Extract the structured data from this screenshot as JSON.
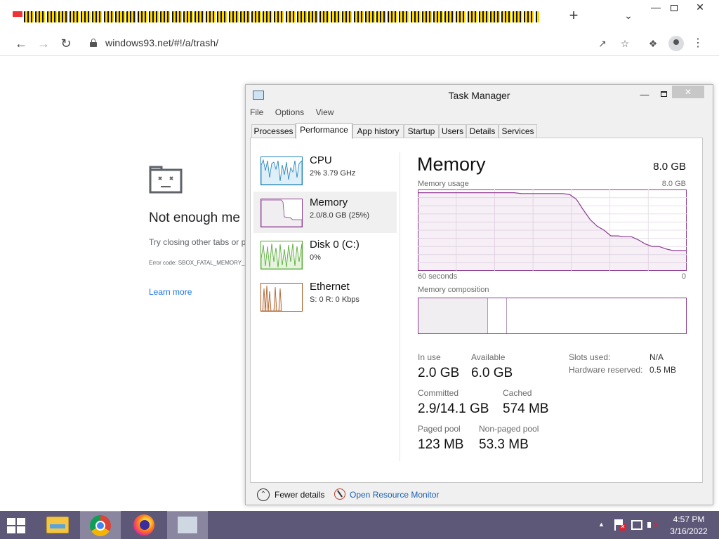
{
  "browser": {
    "tab_count": 49,
    "url": "windows93.net/#!/a/trash/",
    "icons": {
      "back": "arrow-left-icon",
      "forward": "arrow-right-icon",
      "reload": "reload-icon",
      "new_tab": "plus-icon",
      "tab_search": "chevron-down-icon",
      "share": "share-icon",
      "bookmark": "star-icon",
      "extensions": "puzzle-icon",
      "profile": "avatar-icon",
      "menu": "kebab-icon"
    }
  },
  "error_page": {
    "title": "Not enough me",
    "subtitle": "Try closing other tabs or p",
    "error_code": "Error code: SBOX_FATAL_MEMORY_",
    "learn_more": "Learn more"
  },
  "task_manager": {
    "title": "Task Manager",
    "menu": [
      "File",
      "Options",
      "View"
    ],
    "tabs": [
      "Processes",
      "Performance",
      "App history",
      "Startup",
      "Users",
      "Details",
      "Services"
    ],
    "active_tab": "Performance",
    "sidebar": [
      {
        "name": "CPU",
        "detail": "2%  3.79 GHz",
        "color": "#1a7fb8"
      },
      {
        "name": "Memory",
        "detail": "2.0/8.0 GB (25%)",
        "color": "#8b3a8f"
      },
      {
        "name": "Disk 0 (C:)",
        "detail": "0%",
        "color": "#4ea72e"
      },
      {
        "name": "Ethernet",
        "detail": "S: 0  R: 0 Kbps",
        "color": "#a8561f"
      }
    ],
    "memory": {
      "title": "Memory",
      "total": "8.0 GB",
      "usage_label": "Memory usage",
      "usage_max": "8.0 GB",
      "time_left": "60 seconds",
      "time_right": "0",
      "composition_label": "Memory composition",
      "usage_history_fraction": [
        0.96,
        0.96,
        0.96,
        0.96,
        0.96,
        0.96,
        0.96,
        0.96,
        0.96,
        0.96,
        0.96,
        0.96,
        0.96,
        0.96,
        0.96,
        0.95,
        0.95,
        0.95,
        0.95,
        0.95,
        0.95,
        0.95,
        0.94,
        0.88,
        0.75,
        0.63,
        0.55,
        0.5,
        0.43,
        0.43,
        0.42,
        0.42,
        0.38,
        0.33,
        0.3,
        0.3,
        0.27,
        0.25,
        0.25,
        0.25
      ]
    },
    "stats": {
      "in_use_label": "In use",
      "in_use": "2.0 GB",
      "available_label": "Available",
      "available": "6.0 GB",
      "committed_label": "Committed",
      "committed": "2.9/14.1 GB",
      "cached_label": "Cached",
      "cached": "574 MB",
      "paged_label": "Paged pool",
      "paged": "123 MB",
      "nonpaged_label": "Non-paged pool",
      "nonpaged": "53.3 MB",
      "slots_label": "Slots used:",
      "slots": "N/A",
      "hw_label": "Hardware reserved:",
      "hw": "0.5 MB"
    },
    "footer": {
      "fewer_details": "Fewer details",
      "resource_monitor": "Open Resource Monitor"
    },
    "accent": "#8b3a8f"
  },
  "taskbar": {
    "apps": [
      "file-explorer",
      "chrome",
      "firefox",
      "task-manager"
    ],
    "time": "4:57 PM",
    "date": "3/16/2022"
  }
}
